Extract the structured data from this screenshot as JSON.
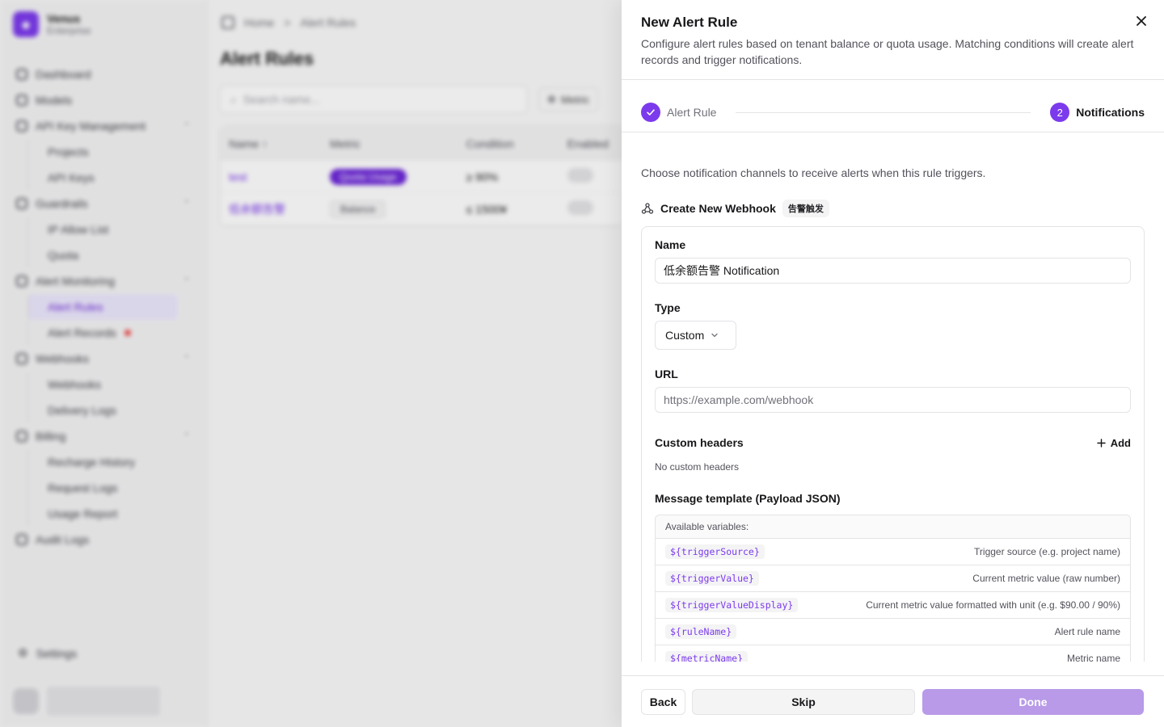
{
  "background": {
    "brand": {
      "name": "Venus",
      "subtitle": "Enterprise"
    },
    "sidebar": {
      "items": [
        {
          "label": "Dashboard"
        },
        {
          "label": "Models"
        },
        {
          "label": "API Key Management"
        },
        {
          "label": "Projects",
          "sub": true
        },
        {
          "label": "API Keys",
          "sub": true
        },
        {
          "label": "Guardrails"
        },
        {
          "label": "IP Allow List",
          "sub": true
        },
        {
          "label": "Quota",
          "sub": true
        },
        {
          "label": "Alert Monitoring"
        },
        {
          "label": "Alert Rules",
          "sub": true,
          "active": true
        },
        {
          "label": "Alert Records",
          "sub": true
        },
        {
          "label": "Webhooks"
        },
        {
          "label": "Webhooks",
          "sub": true
        },
        {
          "label": "Delivery Logs",
          "sub": true
        },
        {
          "label": "Billing"
        },
        {
          "label": "Recharge History",
          "sub": true
        },
        {
          "label": "Request Logs",
          "sub": true
        },
        {
          "label": "Usage Report",
          "sub": true
        },
        {
          "label": "Audit Logs"
        }
      ],
      "settings": "Settings"
    },
    "breadcrumb": {
      "home": "Home",
      "sep": ">",
      "current": "Alert Rules"
    },
    "page_title": "Alert Rules",
    "search_placeholder": "Search name...",
    "metric_filter": "Metric",
    "table": {
      "headers": [
        "Name ↑",
        "Metric",
        "Condition",
        "Enabled"
      ],
      "rows": [
        {
          "name": "test",
          "metric": "Quota Usage",
          "condition": "≥ 90%"
        },
        {
          "name": "低余额告警",
          "metric": "Balance",
          "condition": "≤ 1500¥"
        }
      ]
    }
  },
  "panel": {
    "title": "New Alert Rule",
    "description": "Configure alert rules based on tenant balance or quota usage. Matching conditions will create alert records and trigger notifications.",
    "steps": [
      {
        "number": "1",
        "label": "Alert Rule",
        "state": "complete"
      },
      {
        "number": "2",
        "label": "Notifications",
        "state": "current"
      }
    ],
    "intro": "Choose notification channels to receive alerts when this rule triggers.",
    "webhook_section": {
      "title": "Create New Webhook",
      "tag": "告警触发"
    },
    "form": {
      "name_label": "Name",
      "name_value": "低余额告警 Notification",
      "type_label": "Type",
      "type_value": "Custom",
      "url_label": "URL",
      "url_placeholder": "https://example.com/webhook",
      "headers_label": "Custom headers",
      "add_label": "Add",
      "no_headers": "No custom headers",
      "template_label": "Message template (Payload JSON)",
      "variables_header": "Available variables:",
      "variables": [
        {
          "code": "${triggerSource}",
          "description": "Trigger source (e.g. project name)"
        },
        {
          "code": "${triggerValue}",
          "description": "Current metric value (raw number)"
        },
        {
          "code": "${triggerValueDisplay}",
          "description": "Current metric value formatted with unit (e.g. $90.00 / 90%)"
        },
        {
          "code": "${ruleName}",
          "description": "Alert rule name"
        },
        {
          "code": "${metricName}",
          "description": "Metric name"
        }
      ]
    },
    "footer": {
      "back": "Back",
      "skip": "Skip",
      "done": "Done"
    }
  },
  "colors": {
    "accent": "#7c3aed",
    "done_disabled": "#b89ae8"
  }
}
